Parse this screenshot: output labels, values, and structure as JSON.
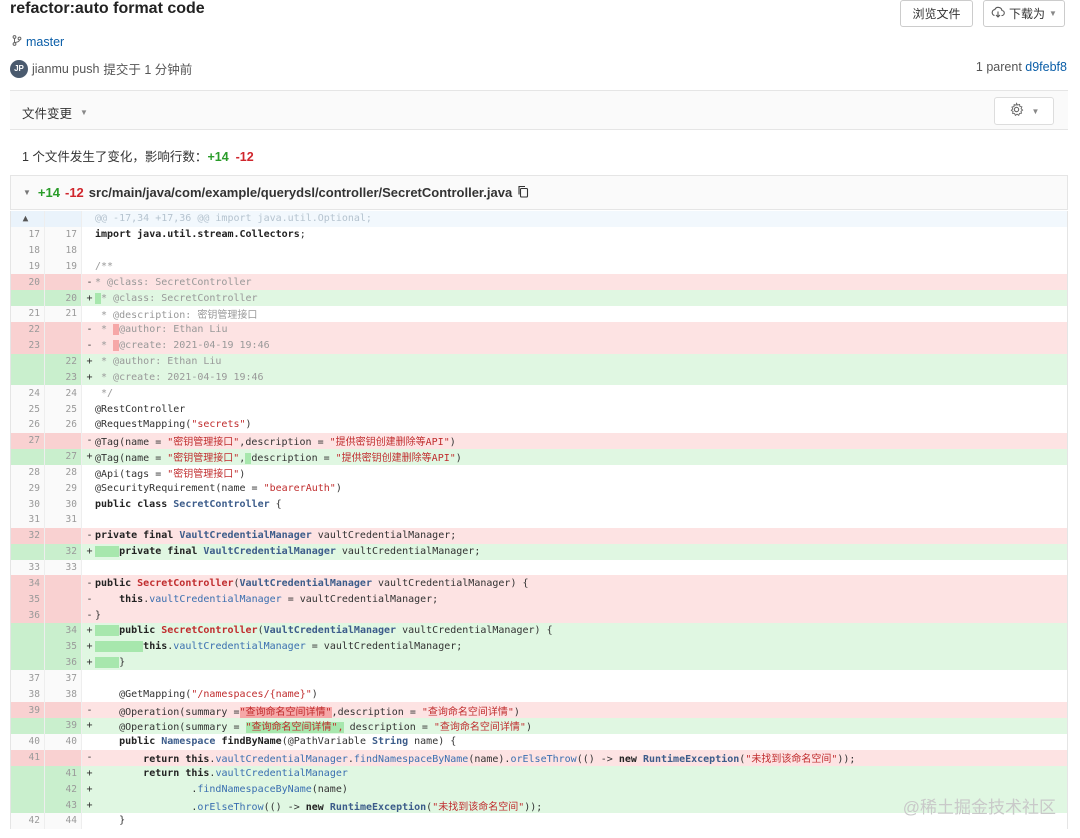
{
  "commit": {
    "title": "refactor:auto format code",
    "branch": "master",
    "avatar_initials": "JP",
    "author": "jianmu push",
    "committed": "提交于 1 分钟前",
    "parent_label": "1 parent",
    "parent_sha": "d9febf8"
  },
  "buttons": {
    "browse": "浏览文件",
    "download": "下载为"
  },
  "files_bar": {
    "label": "文件变更"
  },
  "summary": {
    "text": "1 个文件发生了变化，影响行数：",
    "added": "+14",
    "removed": "-12"
  },
  "file": {
    "added": "+14",
    "removed": "-12",
    "path": "src/main/java/com/example/querydsl/controller/SecretController.java"
  },
  "hunk_header": "@@ -17,34 +17,36 @@ import java.util.Optional;",
  "watermark": "@稀土掘金技术社区",
  "colors": {
    "added_bg": "#e0f7e2",
    "deleted_bg": "#fde3e3",
    "link": "#0a5ea8"
  }
}
